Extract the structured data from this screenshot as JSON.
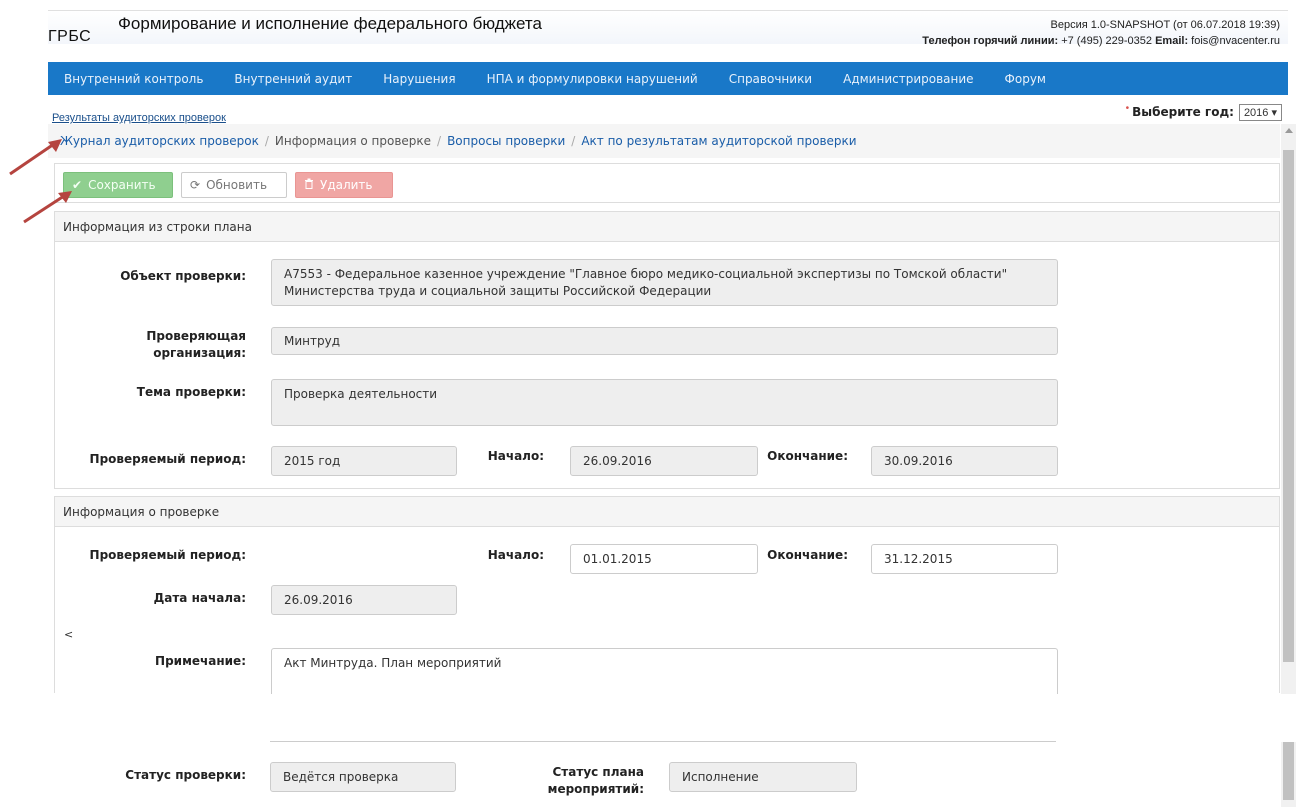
{
  "header": {
    "app_title": "Формирование и исполнение федерального бюджета",
    "org_short": "ГРБС",
    "version": "Версия 1.0-SNAPSHOT (от 06.07.2018 19:39)",
    "hotline_label": "Телефон горячий линии:",
    "hotline_phone": "+7 (495) 229-0352",
    "email_label": "Email:",
    "email": "fois@nvacenter.ru"
  },
  "nav": {
    "items": [
      {
        "label": "Внутренний контроль"
      },
      {
        "label": "Внутренний аудит"
      },
      {
        "label": "Нарушения"
      },
      {
        "label": "НПА и формулировки нарушений"
      },
      {
        "label": "Справочники"
      },
      {
        "label": "Администрирование"
      },
      {
        "label": "Форум"
      }
    ],
    "color": "#1978c8"
  },
  "page": {
    "top_link": "Результаты аудиторских проверок",
    "year_label": "Выберите год:",
    "year_value": "2016 ▾"
  },
  "breadcrumb": {
    "journal": "Журнал аудиторских проверок",
    "info": "Информация о проверке",
    "questions": "Вопросы проверки",
    "act": "Акт по результатам аудиторской проверки",
    "sep": "/"
  },
  "toolbar": {
    "save_label": "Сохранить",
    "refresh_label": "Обновить",
    "delete_label": "Удалить",
    "save_icon": "check-icon",
    "refresh_icon": "refresh-icon",
    "delete_icon": "trash-icon"
  },
  "plan_panel": {
    "title": "Информация из строки плана",
    "object_label": "Объект проверки:",
    "object_value_line1": "А7553 - Федеральное казенное учреждение \"Главное бюро медико-социальной экспертизы по Томской области\"",
    "object_value_line2": "Министерства труда и социальной защиты Российской Федерации",
    "org_label_line1": "Проверяющая",
    "org_label_line2": "организация:",
    "org_value": "Минтруд",
    "topic_label": "Тема проверки:",
    "topic_value": "Проверка деятельности",
    "period_label": "Проверяемый период:",
    "period_value": "2015 год",
    "start_label": "Начало:",
    "start_value": "26.09.2016",
    "end_label": "Окончание:",
    "end_value": "30.09.2016"
  },
  "check_panel": {
    "title": "Информация о проверке",
    "period_label": "Проверяемый период:",
    "start_label": "Начало:",
    "start_value": "01.01.2015",
    "end_label": "Окончание:",
    "end_value": "31.12.2015",
    "date_start_label": "Дата начала:",
    "date_start_value": "26.09.2016",
    "stray_char": "<",
    "note_label": "Примечание:",
    "note_value": "Акт Минтруда. План мероприятий",
    "status_label": "Статус проверки:",
    "status_value": "Ведётся проверка",
    "plan_status_label_line1": "Статус плана",
    "plan_status_label_line2": "мероприятий:",
    "plan_status_value": "Исполнение"
  },
  "colors": {
    "accent": "#1978c8",
    "save_green": "#8fcf8f",
    "delete_red": "#f0a6a4",
    "arrow": "#b5443f"
  }
}
